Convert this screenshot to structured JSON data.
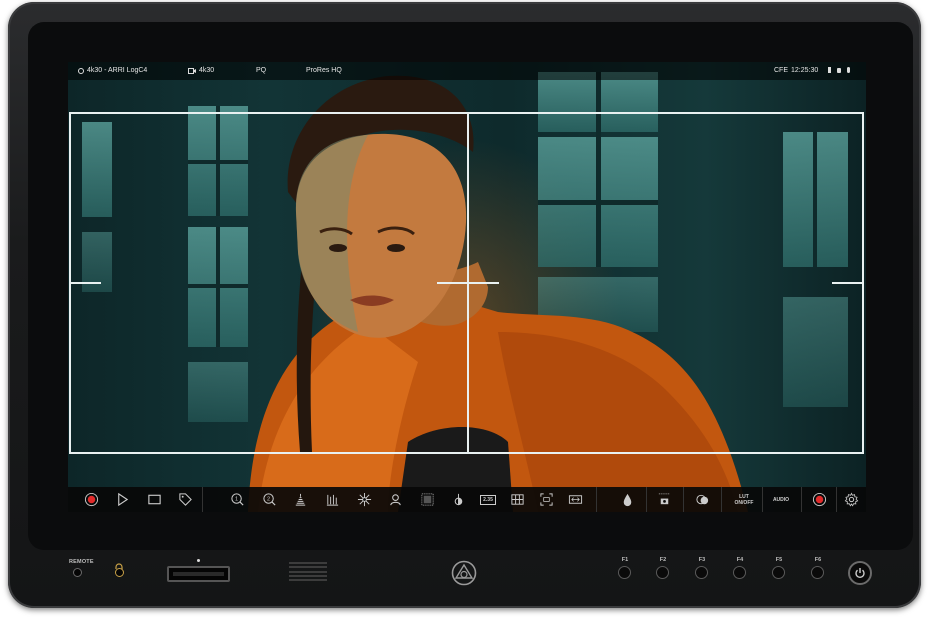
{
  "status_bar": {
    "input": "4k30 - ARRI LogC4",
    "record_format": "4k30",
    "transfer": "PQ",
    "codec": "ProRes HQ",
    "media": "CFE",
    "timecode": "12:25:30"
  },
  "toolbar": {
    "items": [
      "record-indicator-icon",
      "play-icon",
      "stop-icon",
      "tag-icon",
      "zoom-1-icon",
      "zoom-2-icon",
      "waveform-icon",
      "parade-icon",
      "focus-peaking-icon",
      "skin-tone-icon",
      "false-color-icon",
      "exposure-icon",
      "aspect-ratio-icon",
      "grid-icon",
      "frame-guides-icon",
      "anamorphic-icon",
      "drop-icon",
      "snapshot-icon",
      "overlay-toggle-icon",
      "lut-on-off-button",
      "audio-button",
      "record-button",
      "settings-icon"
    ],
    "aspect_label": "2.35",
    "lut_label_line1": "LUT",
    "lut_label_line2": "ON/OFF",
    "audio_label": "AUDIO"
  },
  "hardware": {
    "remote_label": "REMOTE",
    "function_keys": [
      "F1",
      "F2",
      "F3",
      "F4",
      "F5",
      "F6"
    ]
  },
  "colors": {
    "record_red": "#e02a2a",
    "guide_white": "#e9f1f1",
    "bezel": "#0b0c0d"
  }
}
